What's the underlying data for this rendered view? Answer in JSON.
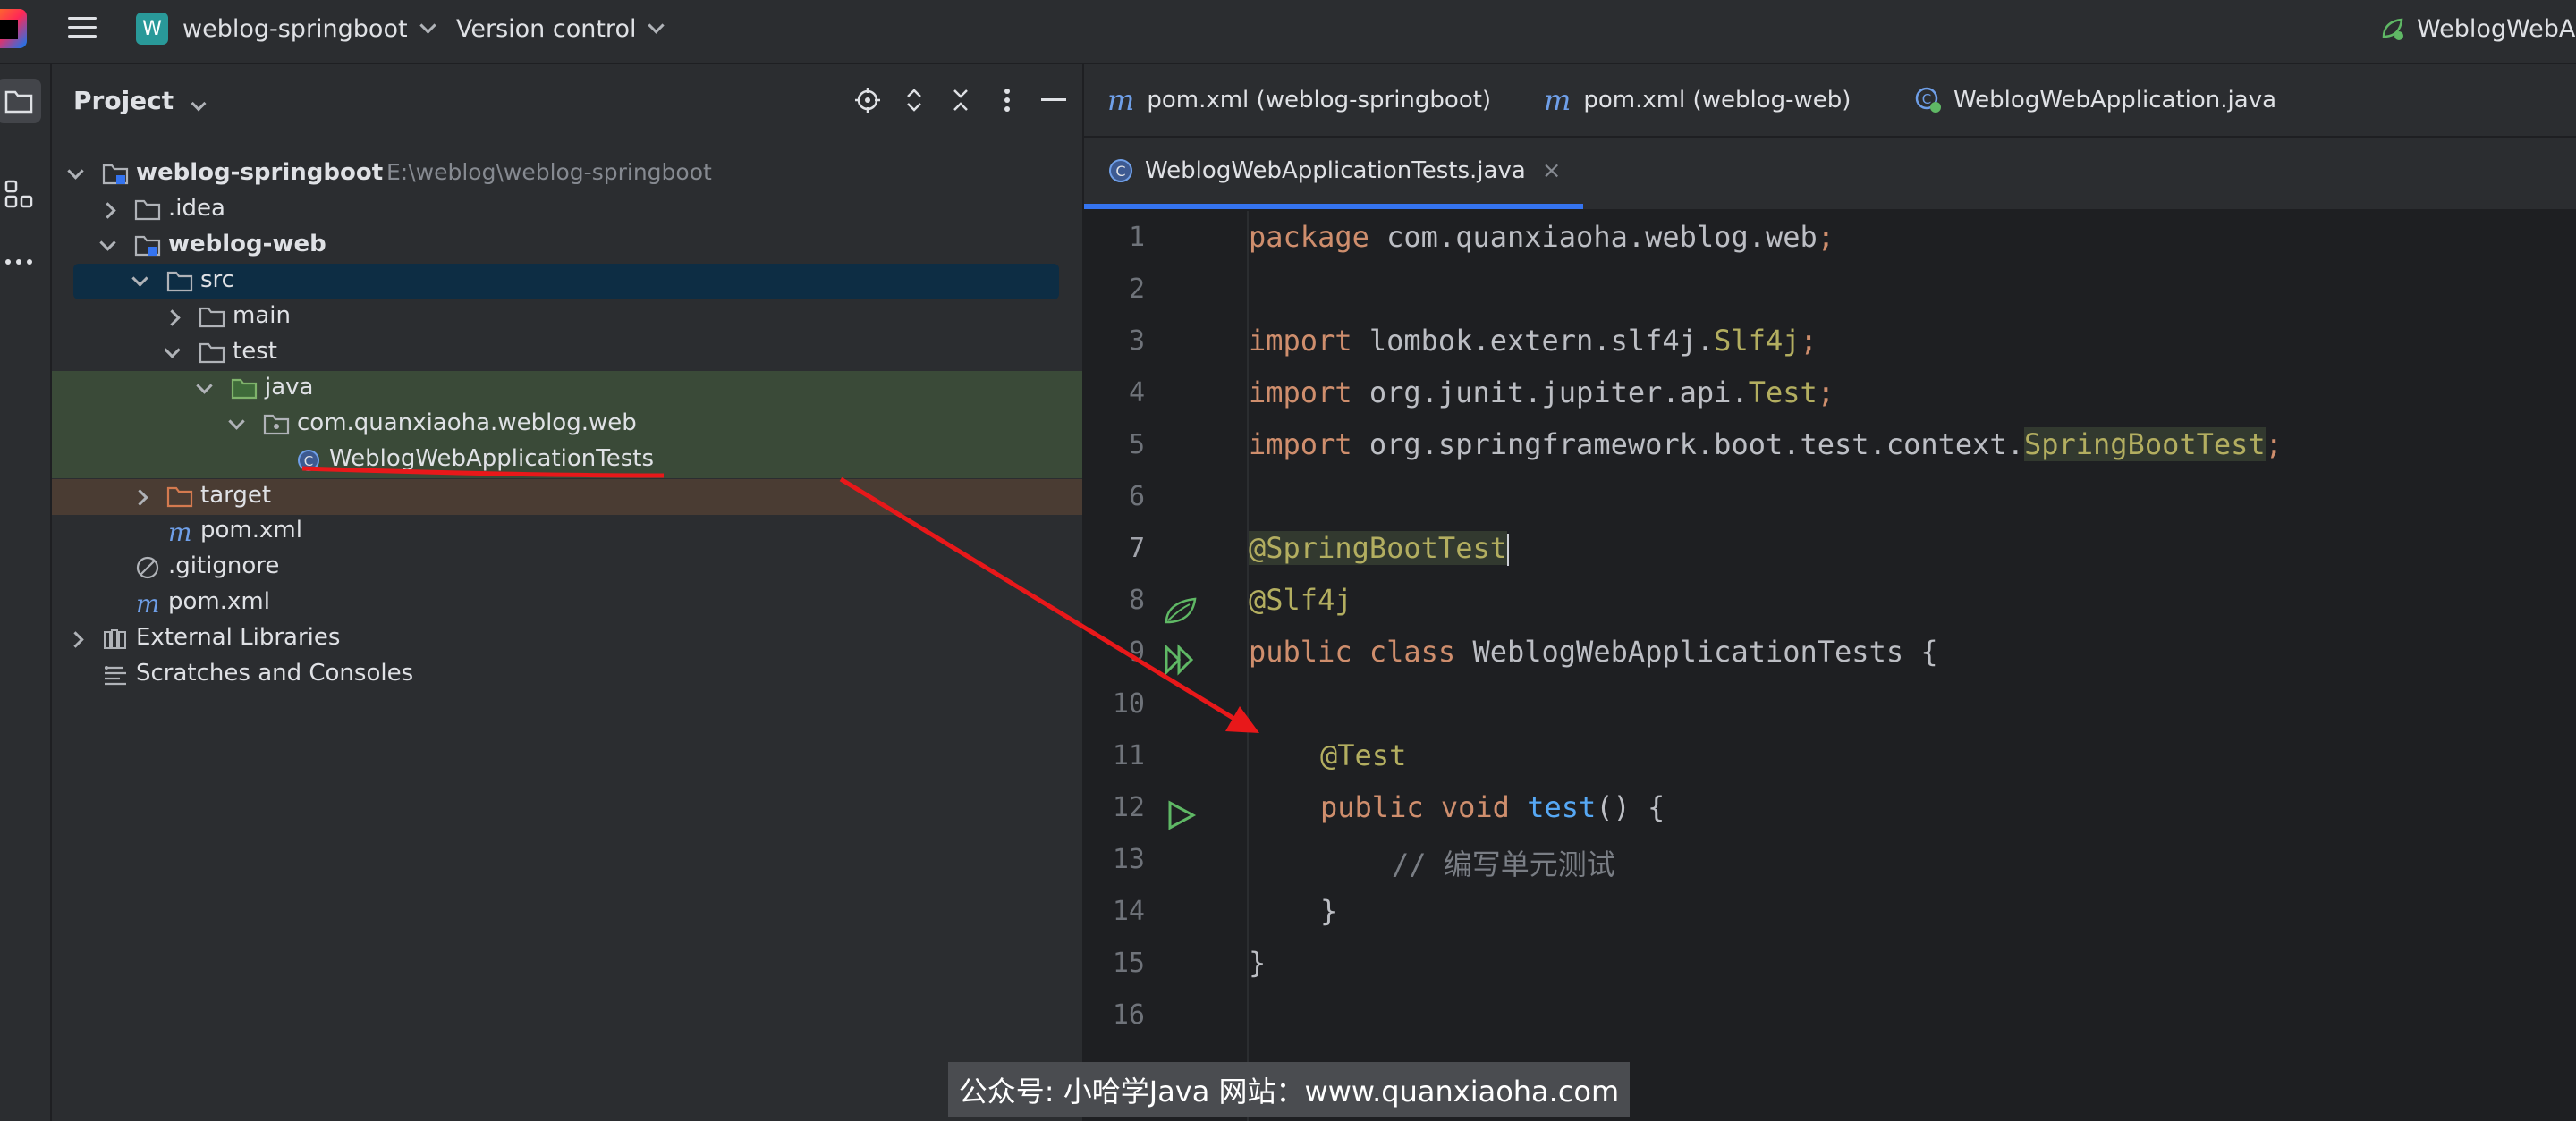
{
  "titlebar": {
    "project_badge": "W",
    "project_name": "weblog-springboot",
    "vcs_label": "Version control",
    "run_config": "WeblogWebAp"
  },
  "project_panel": {
    "title": "Project",
    "tree": [
      {
        "label": "weblog-springboot",
        "path": "E:\\weblog\\weblog-springboot",
        "depth": 0,
        "arrow": "open",
        "icon": "module-folder-icon"
      },
      {
        "label": ".idea",
        "path": "",
        "depth": 1,
        "arrow": "closed",
        "icon": "folder-icon"
      },
      {
        "label": "weblog-web",
        "path": "",
        "depth": 1,
        "arrow": "open",
        "icon": "module-folder-icon"
      },
      {
        "label": "src",
        "path": "",
        "depth": 2,
        "arrow": "open",
        "icon": "folder-icon"
      },
      {
        "label": "main",
        "path": "",
        "depth": 3,
        "arrow": "closed",
        "icon": "folder-icon"
      },
      {
        "label": "test",
        "path": "",
        "depth": 3,
        "arrow": "open",
        "icon": "folder-icon"
      },
      {
        "label": "java",
        "path": "",
        "depth": 4,
        "arrow": "open",
        "icon": "test-source-folder-icon"
      },
      {
        "label": "com.quanxiaoha.weblog.web",
        "path": "",
        "depth": 5,
        "arrow": "open",
        "icon": "package-icon"
      },
      {
        "label": "WeblogWebApplicationTests",
        "path": "",
        "depth": 6,
        "arrow": "none",
        "icon": "java-class-icon"
      },
      {
        "label": "target",
        "path": "",
        "depth": 2,
        "arrow": "closed",
        "icon": "excluded-folder-icon"
      },
      {
        "label": "pom.xml",
        "path": "",
        "depth": 2,
        "arrow": "none",
        "icon": "maven-icon"
      },
      {
        "label": ".gitignore",
        "path": "",
        "depth": 1,
        "arrow": "none",
        "icon": "ignore-file-icon"
      },
      {
        "label": "pom.xml",
        "path": "",
        "depth": 1,
        "arrow": "none",
        "icon": "maven-icon"
      },
      {
        "label": "External Libraries",
        "path": "",
        "depth": 0,
        "arrow": "closed",
        "icon": "library-icon"
      },
      {
        "label": "Scratches and Consoles",
        "path": "",
        "depth": 0,
        "arrow": "none",
        "icon": "scratches-icon"
      }
    ]
  },
  "editor": {
    "tabs": [
      {
        "label": "pom.xml (weblog-springboot)",
        "icon": "maven-icon"
      },
      {
        "label": "pom.xml (weblog-web)",
        "icon": "maven-icon"
      },
      {
        "label": "WeblogWebApplication.java",
        "icon": "spring-class-icon"
      },
      {
        "label": "WeblogWebApplicationTests.java",
        "icon": "java-class-icon",
        "active": true
      }
    ],
    "close_glyph": "×",
    "line_numbers": [
      "1",
      "2",
      "3",
      "4",
      "5",
      "6",
      "7",
      "8",
      "9",
      "10",
      "11",
      "12",
      "13",
      "14",
      "15",
      "16"
    ],
    "code": {
      "l1_kw": "package",
      "l1_rest": " com.quanxiaoha.weblog.web",
      "l1_semi": ";",
      "l3_kw": "import",
      "l3_rest": " lombok.extern.slf4j.",
      "l3_cls": "Slf4j",
      "l3_semi": ";",
      "l4_kw": "import",
      "l4_rest": " org.junit.jupiter.api.",
      "l4_cls": "Test",
      "l4_semi": ";",
      "l5_kw": "import",
      "l5_rest": " org.springframework.boot.test.context.",
      "l5_cls": "SpringBootTest",
      "l5_semi": ";",
      "l7_an": "@SpringBootTest",
      "l8_an": "@Slf4j",
      "l9_kw": "public class",
      "l9_rest": " WeblogWebApplicationTests {",
      "l11_an": "@Test",
      "l12_kw": "public void",
      "l12_fn": "test",
      "l12_rest": "() {",
      "l13_cmt": "// 编写单元测试",
      "l14": "}",
      "l15": "}"
    }
  },
  "colors": {
    "accent": "#3574f0",
    "arrow_annotation": "#e8181a"
  },
  "watermark": "公众号: 小哈学Java  网站：www.quanxiaoha.com"
}
